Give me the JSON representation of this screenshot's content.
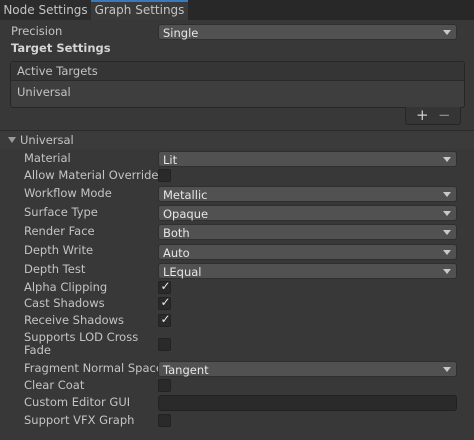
{
  "tabs": [
    "Node Settings",
    "Graph Settings"
  ],
  "precision": {
    "label": "Precision",
    "value": "Single"
  },
  "target_settings": {
    "title": "Target Settings",
    "active_targets_header": "Active Targets",
    "targets": [
      "Universal"
    ],
    "add_symbol": "+",
    "remove_symbol": "−"
  },
  "universal": {
    "title": "Universal",
    "material": {
      "label": "Material",
      "value": "Lit"
    },
    "allow_material_override": {
      "label": "Allow Material Override",
      "checked": false
    },
    "workflow_mode": {
      "label": "Workflow Mode",
      "value": "Metallic"
    },
    "surface_type": {
      "label": "Surface Type",
      "value": "Opaque"
    },
    "render_face": {
      "label": "Render Face",
      "value": "Both"
    },
    "depth_write": {
      "label": "Depth Write",
      "value": "Auto"
    },
    "depth_test": {
      "label": "Depth Test",
      "value": "LEqual"
    },
    "alpha_clipping": {
      "label": "Alpha Clipping",
      "checked": true
    },
    "cast_shadows": {
      "label": "Cast Shadows",
      "checked": true
    },
    "receive_shadows": {
      "label": "Receive Shadows",
      "checked": true
    },
    "supports_lod_cross_fade": {
      "label_line1": "Supports LOD Cross",
      "label_line2": "Fade",
      "checked": false
    },
    "fragment_normal_space": {
      "label": "Fragment Normal Space",
      "value": "Tangent"
    },
    "clear_coat": {
      "label": "Clear Coat",
      "checked": false
    },
    "custom_editor_gui": {
      "label": "Custom Editor GUI",
      "value": ""
    },
    "support_vfx_graph": {
      "label": "Support VFX Graph",
      "checked": false
    }
  },
  "check_symbol": "✓"
}
